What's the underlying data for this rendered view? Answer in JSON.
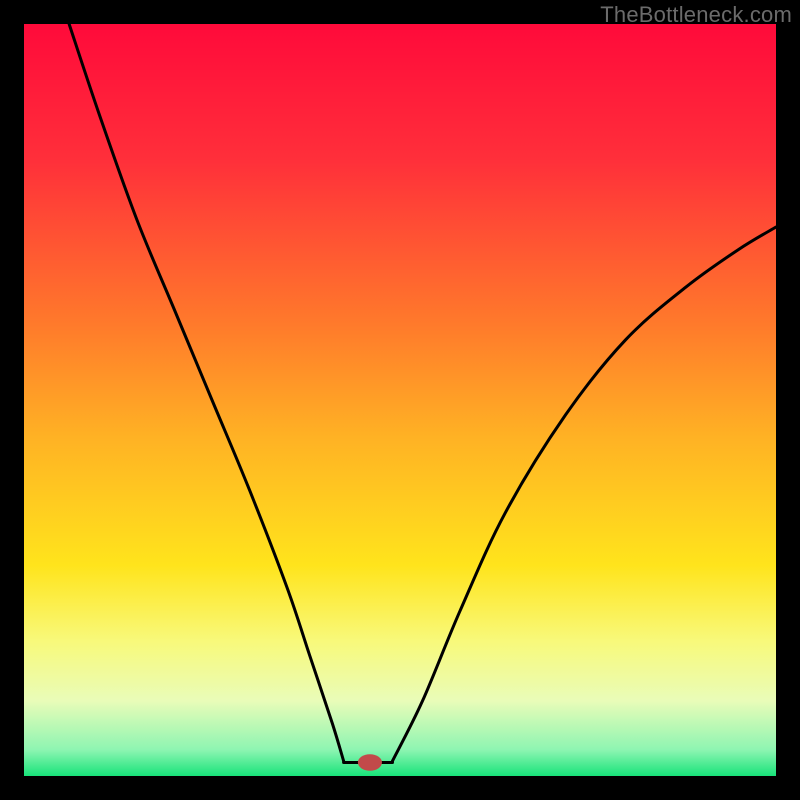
{
  "watermark": "TheBottleneck.com",
  "chart_data": {
    "type": "line",
    "title": "",
    "xlabel": "",
    "ylabel": "",
    "xlim": [
      0,
      100
    ],
    "ylim": [
      0,
      100
    ],
    "gradient_stops": [
      {
        "offset": 0.0,
        "color": "#ff0a3a"
      },
      {
        "offset": 0.18,
        "color": "#ff2f3a"
      },
      {
        "offset": 0.4,
        "color": "#ff7a2b"
      },
      {
        "offset": 0.55,
        "color": "#ffb224"
      },
      {
        "offset": 0.72,
        "color": "#ffe41c"
      },
      {
        "offset": 0.82,
        "color": "#f8f97a"
      },
      {
        "offset": 0.9,
        "color": "#e9fcb8"
      },
      {
        "offset": 0.965,
        "color": "#8ef5b2"
      },
      {
        "offset": 1.0,
        "color": "#18e37a"
      }
    ],
    "curve_left": [
      {
        "x": 6.0,
        "y": 100.0
      },
      {
        "x": 10.0,
        "y": 88.0
      },
      {
        "x": 15.0,
        "y": 74.0
      },
      {
        "x": 20.0,
        "y": 62.0
      },
      {
        "x": 25.0,
        "y": 50.0
      },
      {
        "x": 30.0,
        "y": 38.0
      },
      {
        "x": 35.0,
        "y": 25.0
      },
      {
        "x": 38.0,
        "y": 16.0
      },
      {
        "x": 41.0,
        "y": 7.0
      },
      {
        "x": 42.5,
        "y": 2.0
      }
    ],
    "curve_right": [
      {
        "x": 49.0,
        "y": 2.0
      },
      {
        "x": 53.0,
        "y": 10.0
      },
      {
        "x": 58.0,
        "y": 22.0
      },
      {
        "x": 64.0,
        "y": 35.0
      },
      {
        "x": 72.0,
        "y": 48.0
      },
      {
        "x": 80.0,
        "y": 58.0
      },
      {
        "x": 88.0,
        "y": 65.0
      },
      {
        "x": 95.0,
        "y": 70.0
      },
      {
        "x": 100.0,
        "y": 73.0
      }
    ],
    "flat_segment": {
      "x1": 42.5,
      "y": 1.8,
      "x2": 49.0
    },
    "marker": {
      "x": 46.0,
      "y": 1.8,
      "rx": 1.6,
      "ry": 1.1,
      "color": "#c24a4a"
    }
  }
}
